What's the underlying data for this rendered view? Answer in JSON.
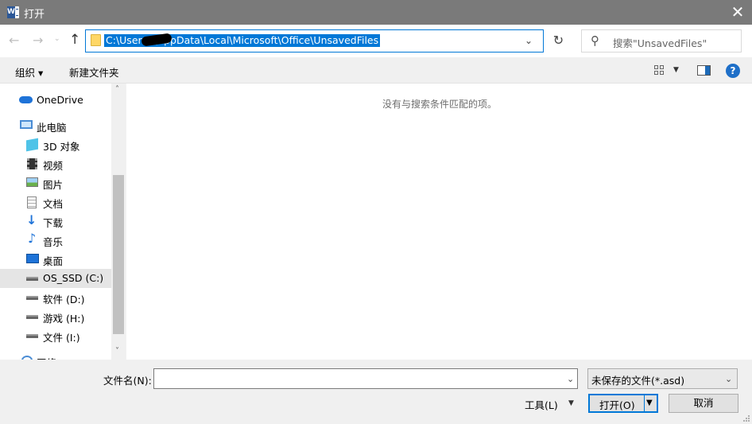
{
  "window": {
    "title": "打开",
    "app_icon_letter": "W",
    "close_glyph": "✕"
  },
  "nav": {
    "back_glyph": "←",
    "forward_glyph": "→",
    "recent_glyph": "⌄",
    "up_glyph": "↑",
    "address": "C:\\Users\\      \\AppData\\Local\\Microsoft\\Office\\UnsavedFiles",
    "address_dropdown_glyph": "⌄",
    "refresh_glyph": "↻",
    "search_placeholder": "搜索\"UnsavedFiles\"",
    "search_glyph": "⚲"
  },
  "toolbar": {
    "organize_label": "组织 ▾",
    "new_folder_label": "新建文件夹",
    "view_dropdown_glyph": "▼",
    "help_glyph": "?"
  },
  "tree": {
    "items": [
      {
        "label": "OneDrive",
        "icon": "cloud-icon"
      },
      {
        "label": "此电脑",
        "icon": "computer-icon"
      },
      {
        "label": "3D 对象",
        "icon": "3d-objects-icon"
      },
      {
        "label": "视频",
        "icon": "video-icon"
      },
      {
        "label": "图片",
        "icon": "pictures-icon"
      },
      {
        "label": "文档",
        "icon": "documents-icon"
      },
      {
        "label": "下载",
        "icon": "download-icon"
      },
      {
        "label": "音乐",
        "icon": "music-icon"
      },
      {
        "label": "桌面",
        "icon": "desktop-icon"
      },
      {
        "label": "OS_SSD (C:)",
        "icon": "system-drive-icon"
      },
      {
        "label": "软件 (D:)",
        "icon": "drive-icon"
      },
      {
        "label": "游戏 (H:)",
        "icon": "drive-icon"
      },
      {
        "label": "文件 (I:)",
        "icon": "drive-icon"
      },
      {
        "label": "网络",
        "icon": "network-icon"
      }
    ],
    "scroll_up_glyph": "˄",
    "scroll_down_glyph": "˅"
  },
  "main": {
    "empty_message": "没有与搜索条件匹配的项。"
  },
  "bottom": {
    "filename_label": "文件名(N):",
    "filename_value": "",
    "filename_dropdown_glyph": "⌄",
    "filetype_value": "未保存的文件(*.asd)",
    "filetype_arrow_glyph": "⌄",
    "tools_label": "工具(L)",
    "tools_arrow_glyph": "▼",
    "open_label": "打开(O)",
    "open_arrow_glyph": "▼",
    "cancel_label": "取消"
  },
  "colors": {
    "titlebar": "#7a7a7a",
    "accent": "#0078d7",
    "selection": "#e5e5e5"
  }
}
